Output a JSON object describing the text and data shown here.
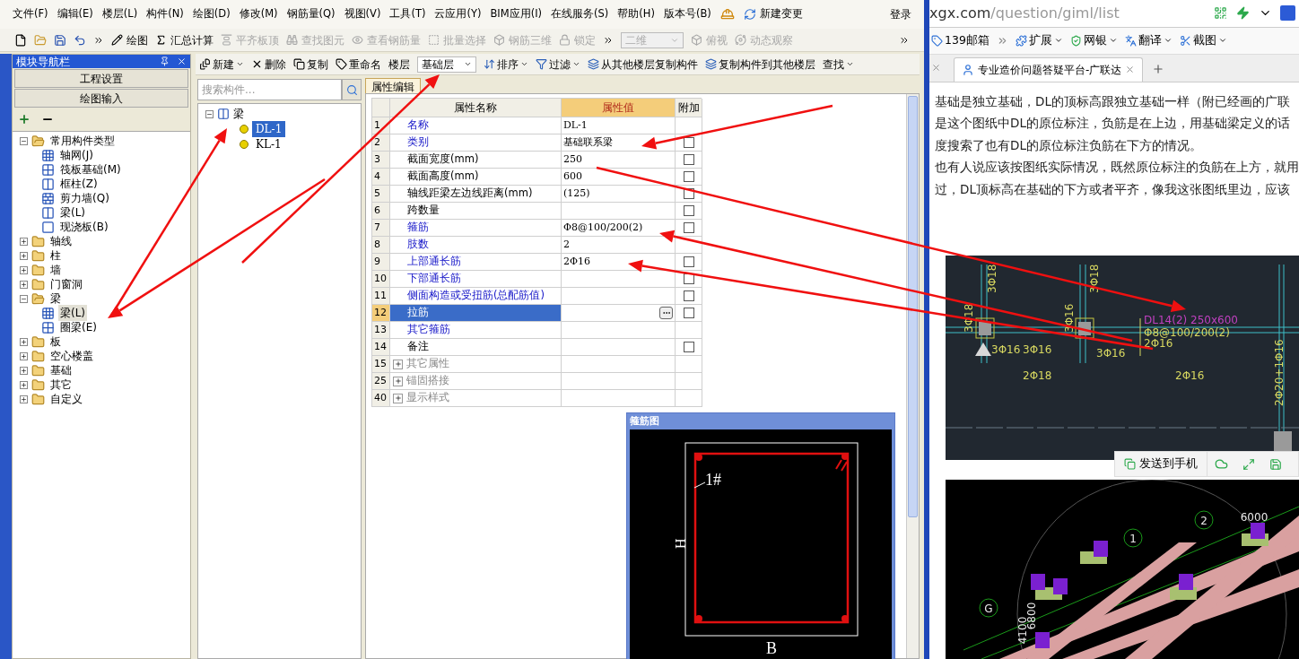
{
  "app": {
    "menu": [
      "文件(F)",
      "编辑(E)",
      "楼层(L)",
      "构件(N)",
      "绘图(D)",
      "修改(M)",
      "钢筋量(Q)",
      "视图(V)",
      "工具(T)",
      "云应用(Y)",
      "BIM应用(I)",
      "在线服务(S)",
      "帮助(H)",
      "版本号(B)"
    ],
    "menu_change": "新建变更",
    "login": "登录",
    "toolbar": [
      {
        "label": "绘图",
        "disabled": false
      },
      {
        "label": "汇总计算",
        "disabled": false
      },
      {
        "label": "平齐板顶",
        "disabled": true
      },
      {
        "label": "查找图元",
        "disabled": true
      },
      {
        "label": "查看钢筋量",
        "disabled": true
      },
      {
        "label": "批量选择",
        "disabled": true
      },
      {
        "label": "钢筋三维",
        "disabled": true
      },
      {
        "label": "锁定",
        "disabled": true
      }
    ],
    "view_select": {
      "value": "二维",
      "disabled": true
    },
    "view_tools": [
      {
        "label": "俯视",
        "disabled": true
      },
      {
        "label": "动态观察",
        "disabled": true
      }
    ]
  },
  "nav": {
    "title": "模块导航栏",
    "buttons": [
      "工程设置",
      "绘图输入"
    ],
    "tree": [
      {
        "label": "常用构件类型",
        "expanded": true,
        "selected": false,
        "children": [
          {
            "label": "轴网(J)",
            "selected": false
          },
          {
            "label": "筏板基础(M)",
            "selected": false
          },
          {
            "label": "框柱(Z)",
            "selected": false
          },
          {
            "label": "剪力墙(Q)",
            "selected": false
          },
          {
            "label": "梁(L)",
            "selected": false
          },
          {
            "label": "现浇板(B)",
            "selected": false
          }
        ]
      },
      {
        "label": "轴线",
        "expanded": false,
        "selected": false
      },
      {
        "label": "柱",
        "expanded": false,
        "selected": false
      },
      {
        "label": "墙",
        "expanded": false,
        "selected": false
      },
      {
        "label": "门窗洞",
        "expanded": false,
        "selected": false
      },
      {
        "label": "梁",
        "expanded": true,
        "selected": false,
        "children": [
          {
            "label": "梁(L)",
            "selected": true
          },
          {
            "label": "圈梁(E)",
            "selected": false
          }
        ]
      },
      {
        "label": "板",
        "expanded": false,
        "selected": false
      },
      {
        "label": "空心楼盖",
        "expanded": false,
        "selected": false
      },
      {
        "label": "基础",
        "expanded": false,
        "selected": false
      },
      {
        "label": "其它",
        "expanded": false,
        "selected": false
      },
      {
        "label": "自定义",
        "expanded": false,
        "selected": false
      }
    ]
  },
  "component_toolbar": {
    "before": [
      {
        "label": "新建",
        "dropdown": true
      },
      {
        "label": "删除",
        "dropdown": false
      },
      {
        "label": "复制",
        "dropdown": false
      },
      {
        "label": "重命名",
        "dropdown": false
      }
    ],
    "floor_label": "楼层",
    "floor_value": "基础层",
    "after": [
      {
        "label": "排序",
        "dropdown": true
      },
      {
        "label": "过滤",
        "dropdown": true
      },
      {
        "label": "从其他楼层复制构件",
        "dropdown": false
      },
      {
        "label": "复制构件到其他楼层",
        "dropdown": false
      },
      {
        "label": "查找",
        "dropdown": true
      }
    ]
  },
  "component_list": {
    "search_placeholder": "搜索构件...",
    "tree": [
      {
        "label": "梁",
        "expanded": true,
        "children": [
          {
            "label": "DL-1",
            "selected": true
          },
          {
            "label": "KL-1",
            "selected": false
          }
        ]
      }
    ]
  },
  "properties": {
    "tab": {
      "label": "属性编辑",
      "selected": true
    },
    "columns": [
      "属性名称",
      "属性值",
      "附加"
    ],
    "rows": [
      {
        "no": "1",
        "name": "名称",
        "kind": "public",
        "value": "DL-1",
        "selected": false
      },
      {
        "no": "2",
        "name": "类别",
        "kind": "public",
        "value": "基础联系梁",
        "selected": false,
        "checked": false
      },
      {
        "no": "3",
        "name": "截面宽度(mm)",
        "kind": "private",
        "value": "250",
        "selected": false,
        "checked": false
      },
      {
        "no": "4",
        "name": "截面高度(mm)",
        "kind": "private",
        "value": "600",
        "selected": false,
        "checked": false
      },
      {
        "no": "5",
        "name": "轴线距梁左边线距离(mm)",
        "kind": "private",
        "value": "(125)",
        "selected": false,
        "checked": false
      },
      {
        "no": "6",
        "name": "跨数量",
        "kind": "private",
        "selected": false,
        "checked": false
      },
      {
        "no": "7",
        "name": "箍筋",
        "kind": "public",
        "value": "Φ8@100/200(2)",
        "selected": false,
        "checked": false
      },
      {
        "no": "8",
        "name": "肢数",
        "kind": "public",
        "value": "2",
        "selected": false
      },
      {
        "no": "9",
        "name": "上部通长筋",
        "kind": "public",
        "value": "2Φ16",
        "selected": false,
        "checked": false
      },
      {
        "no": "10",
        "name": "下部通长筋",
        "kind": "public",
        "selected": false,
        "checked": false
      },
      {
        "no": "11",
        "name": "侧面构造或受扭筋(总配筋值)",
        "kind": "public",
        "selected": false,
        "checked": false
      },
      {
        "no": "12",
        "name": "拉筋",
        "kind": "public",
        "selected": true,
        "checked": false
      },
      {
        "no": "13",
        "name": "其它箍筋",
        "kind": "public",
        "selected": false
      },
      {
        "no": "14",
        "name": "备注",
        "kind": "private",
        "selected": false,
        "checked": false
      },
      {
        "no": "15",
        "name": "其它属性",
        "kind": "group",
        "expanded": false,
        "selected": false
      },
      {
        "no": "25",
        "name": "锚固搭接",
        "kind": "group",
        "expanded": false,
        "selected": false
      },
      {
        "no": "40",
        "name": "显示样式",
        "kind": "group",
        "expanded": false,
        "selected": false
      }
    ]
  },
  "rebar_window": {
    "title": "箍筋图",
    "tag": "1#",
    "height_label": "H",
    "width_label": "B"
  },
  "browser": {
    "address_host": "xgx.com",
    "address_path": "/question/giml/list",
    "bookmarks": [
      {
        "label": "139邮箱",
        "dropdown": false
      },
      {
        "label": "扩展",
        "dropdown": true
      },
      {
        "label": "网银",
        "dropdown": true
      },
      {
        "label": "翻译",
        "dropdown": true
      },
      {
        "label": "截图",
        "dropdown": true
      }
    ],
    "tabs": [
      {
        "label": "专业造价问题答疑平台-广联达",
        "selected": true
      }
    ],
    "paragraphs": [
      [
        "基础是独立基础，DL的顶标高跟独立基础一样（附已经画的广联",
        "是这个图纸中DL的原位标注，负筋是在上边，用基础梁定义的话",
        "度搜索了也有DL的原位标注负筋在下方的情况。"
      ],
      [
        "也有人说应该按图纸实际情况，既然原位标注的负筋在上方，就用",
        "过，DL顶标高在基础的下方或者平齐，像我这张图纸里边，应该"
      ]
    ],
    "cad_labels": [
      {
        "text": "DL14(2) 250x600",
        "kind": "title"
      },
      {
        "text": "Φ8@100/200(2)",
        "kind": "note"
      },
      {
        "text": "2Φ16",
        "kind": "note"
      },
      {
        "text": "3Φ16",
        "kind": "note"
      },
      {
        "text": "3Φ16",
        "kind": "note"
      },
      {
        "text": "3Φ16",
        "kind": "note"
      },
      {
        "text": "2Φ18",
        "kind": "note"
      },
      {
        "text": "2Φ16",
        "kind": "note"
      },
      {
        "text": "3Φ18",
        "kind": "note"
      },
      {
        "text": "3Φ18",
        "kind": "note"
      },
      {
        "text": "3Φ18",
        "kind": "note"
      },
      {
        "text": "3Φ16",
        "kind": "note"
      },
      {
        "text": "2Φ20+1Φ16",
        "kind": "note"
      }
    ],
    "model_labels": [
      "1",
      "2",
      "6000",
      "G",
      "4100",
      "6800"
    ],
    "share_button": "发送到手机"
  }
}
